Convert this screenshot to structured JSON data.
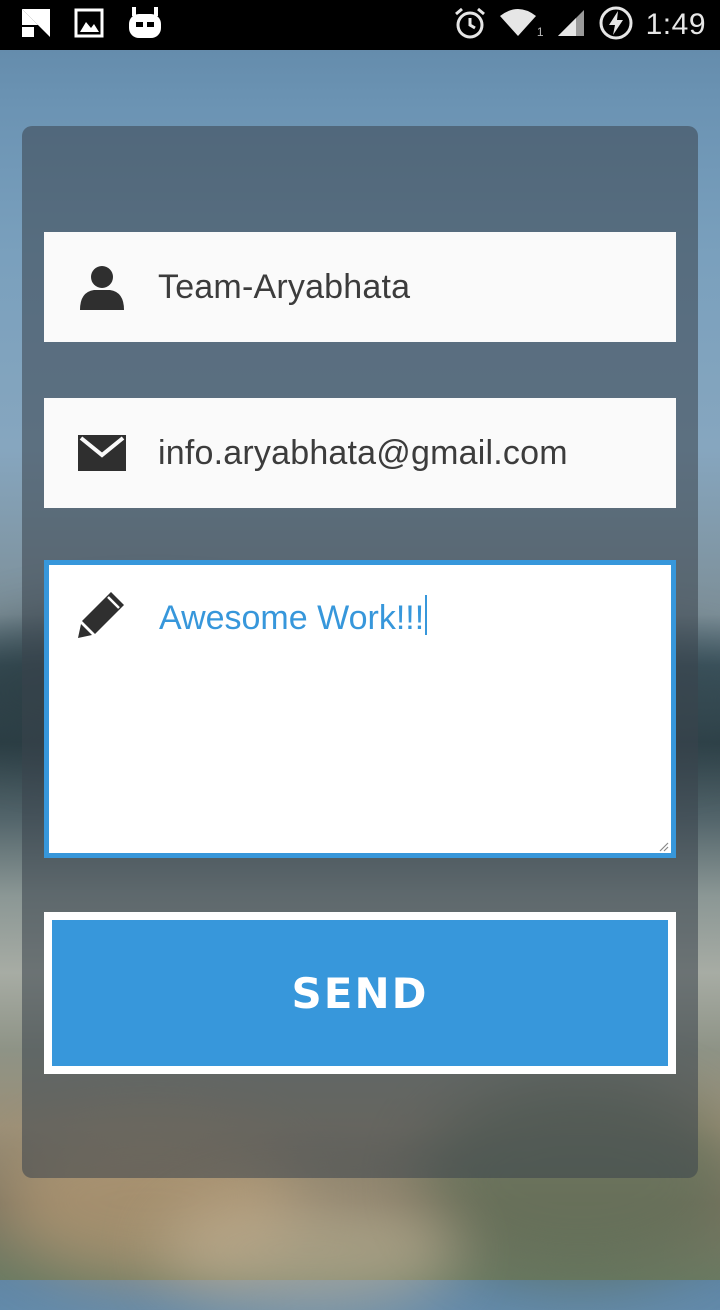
{
  "status_bar": {
    "time": "1:49",
    "signal_sub": "1",
    "icons": [
      "notification-icon",
      "gallery-icon",
      "cyanogenmod-icon",
      "alarm-icon",
      "wifi-icon",
      "cell-signal-icon",
      "battery-charging-icon"
    ]
  },
  "form": {
    "name_value": "Team-Aryabhata",
    "email_value": "info.aryabhata@gmail.com",
    "message_value": "Awesome Work!!!",
    "send_label": "SEND"
  },
  "colors": {
    "accent": "#3797db",
    "field_bg": "#fafafa",
    "text": "#3c3c3c"
  }
}
